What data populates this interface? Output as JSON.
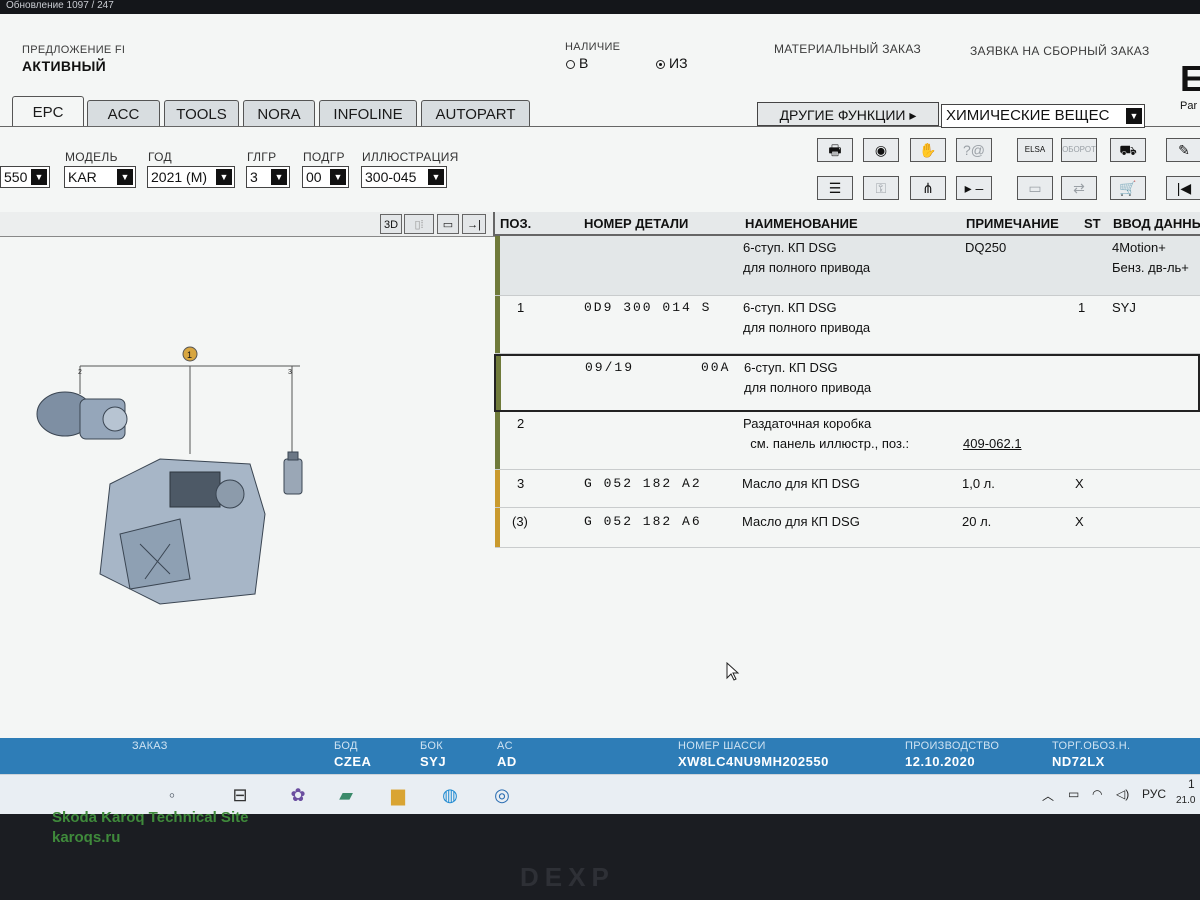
{
  "window": {
    "title": "Обновление 1097 / 247"
  },
  "header": {
    "offer_label": "ПРЕДЛОЖЕНИЕ FI",
    "offer_value": "АКТИВНЫЙ",
    "availability_label": "НАЛИЧИЕ",
    "radio_in": "В",
    "radio_from": "ИЗ",
    "material_order": "МАТЕРИАЛЬНЫЙ ЗАКАЗ",
    "assembly_order": "ЗАЯВКА НА СБОРНЫЙ ЗАКАЗ",
    "logo_letter": "E",
    "logo_sub": "Par"
  },
  "tabs": [
    {
      "label": "EPC",
      "active": true
    },
    {
      "label": "ACC"
    },
    {
      "label": "TOOLS"
    },
    {
      "label": "NORA"
    },
    {
      "label": "INFOLINE"
    },
    {
      "label": "AUTOPART"
    }
  ],
  "functions": {
    "other_label": "ДРУГИЕ ФУНКЦИИ ▸",
    "chem_value": "ХИМИЧЕСКИЕ ВЕЩЕС"
  },
  "selectors": {
    "first_value": "550",
    "model_label": "МОДЕЛЬ",
    "model_value": "KAR",
    "year_label": "ГОД",
    "year_value": "2021 (M)",
    "glgr_label": "ГЛГР",
    "glgr_value": "3",
    "podgr_label": "ПОДГР",
    "podgr_value": "00",
    "illus_label": "ИЛЛЮСТРАЦИЯ",
    "illus_value": "300-045"
  },
  "toolbar": {
    "elsa": "ELSA",
    "oborot": "ОБОРОТ",
    "btn_3d": "3D"
  },
  "table": {
    "headers": {
      "pos": "ПОЗ.",
      "part": "НОМЕР ДЕТАЛИ",
      "name": "НАИМЕНОВАНИЕ",
      "note": "ПРИМЕЧАНИЕ",
      "st": "ST",
      "input": "ВВОД ДАННЫ"
    },
    "rows": [
      {
        "pos": "",
        "part": "",
        "name1": "6-ступ. КП DSG",
        "name2": "для полного привода",
        "note": "DQ250",
        "st": "",
        "input1": "4Motion+",
        "input2": "Бенз. дв-ль+"
      },
      {
        "pos": "1",
        "part": "0D9 300 014 S",
        "name1": "6-ступ. КП DSG",
        "name2": "для полного привода",
        "note": "",
        "st": "1",
        "input1": "SYJ",
        "input2": ""
      },
      {
        "pos": "",
        "part": "09/19",
        "part_suffix": "00A",
        "name1": "6-ступ. КП DSG",
        "name2": "для полного привода",
        "note": "",
        "st": "",
        "input1": "",
        "input2": ""
      },
      {
        "pos": "2",
        "part": "",
        "name1": "Раздаточная коробка",
        "name2": "см. панель иллюстр., поз.:",
        "note": "409-062.1",
        "st": "",
        "input1": "",
        "input2": ""
      },
      {
        "pos": "3",
        "part": "G 052 182 A2",
        "name1": "Масло для КП DSG",
        "name2": "",
        "note": "1,0 л.",
        "st": "X",
        "input1": "",
        "input2": ""
      },
      {
        "pos": "(3)",
        "part": "G 052 182 A6",
        "name1": "Масло для КП DSG",
        "name2": "",
        "note": "20 л.",
        "st": "X",
        "input1": "",
        "input2": ""
      }
    ]
  },
  "illustration": {
    "callout_1": "1",
    "callout_2": "2",
    "callout_3": "3"
  },
  "status": {
    "order_label": "ЗАКАЗ",
    "bod_label": "БОД",
    "bod_value": "CZEA",
    "bok_label": "БОК",
    "bok_value": "SYJ",
    "ac_label": "AC",
    "ac_value": "AD",
    "vin_label": "НОМЕР ШАССИ",
    "vin_value": "XW8LC4NU9MH202550",
    "prod_label": "ПРОИЗВОДСТВО",
    "prod_value": "12.10.2020",
    "trade_label": "ТОРГ.ОБОЗ.Н.",
    "trade_value": "ND72LX"
  },
  "taskbar": {
    "lang": "РУС",
    "time": "1",
    "date": "21.0"
  },
  "watermark": {
    "line1": "Skoda Karoq Technical Site",
    "line2": "karoqs.ru"
  },
  "monitor": {
    "brand": "DEXP"
  },
  "colors": {
    "status_bar": "#2e7db7",
    "row_mark_olive": "#6f7a3a",
    "row_mark_amber": "#c99a2e"
  }
}
